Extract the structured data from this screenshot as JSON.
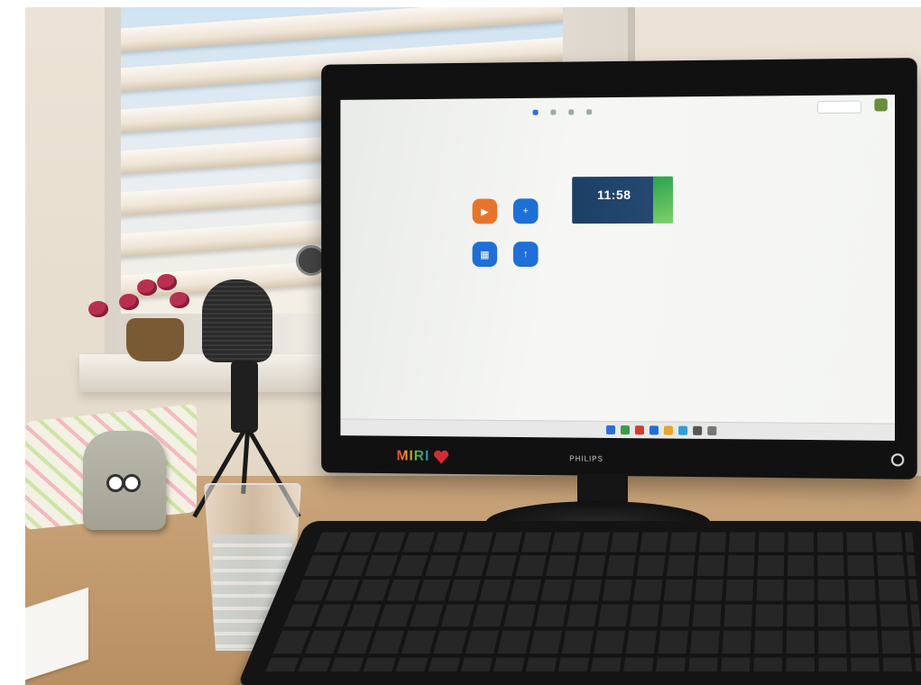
{
  "scene": {
    "description_elements": [
      "window-with-blinds",
      "desk",
      "monitor",
      "keyboard",
      "microphone",
      "glass-of-water",
      "speaker",
      "flowers"
    ]
  },
  "monitor": {
    "brand": "PHILIPS",
    "sticker": "MIRI"
  },
  "zoom_app": {
    "clock_time": "11:58",
    "buttons": [
      {
        "id": "new-meeting",
        "icon": "video-camera-icon",
        "color": "#e8742b"
      },
      {
        "id": "join",
        "icon": "plus-icon",
        "color": "#1e6fd6"
      },
      {
        "id": "schedule",
        "icon": "calendar-icon",
        "color": "#1e6fd6"
      },
      {
        "id": "share-screen",
        "icon": "share-up-icon",
        "color": "#1e6fd6"
      }
    ]
  },
  "colors": {
    "zoom_blue": "#1e6fd6",
    "zoom_orange": "#e8742b",
    "clock_card": "#1c3f66",
    "heart": "#d62b36"
  }
}
